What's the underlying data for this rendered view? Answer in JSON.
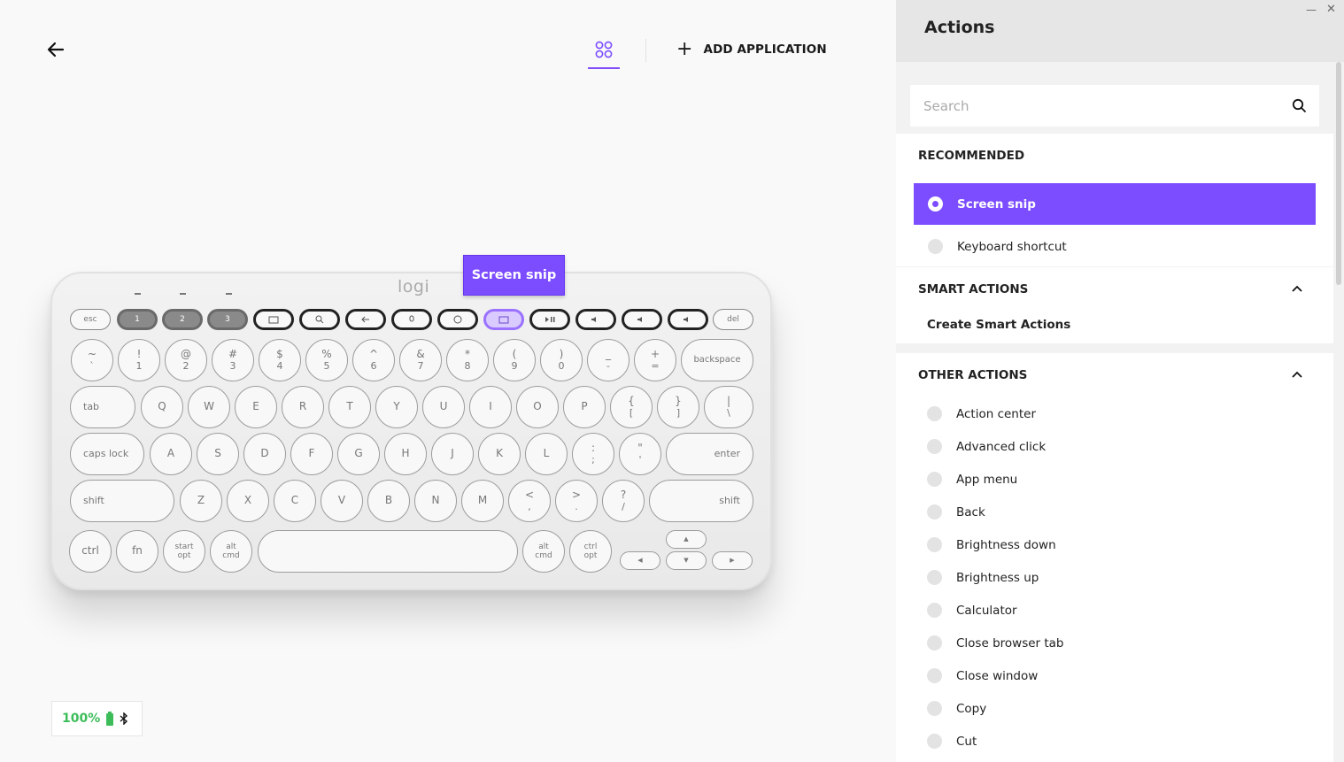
{
  "header": {
    "add_application_label": "ADD APPLICATION"
  },
  "callout": {
    "label": "Screen snip"
  },
  "battery": {
    "percent": "100%"
  },
  "keyboard": {
    "logo": "logi",
    "fn_row": [
      "esc",
      "1",
      "2",
      "3",
      "",
      "",
      "",
      "",
      "",
      "",
      "",
      "",
      "",
      "",
      "del"
    ],
    "row1": [
      {
        "top": "~",
        "bottom": "`"
      },
      {
        "top": "!",
        "bottom": "1"
      },
      {
        "top": "@",
        "bottom": "2"
      },
      {
        "top": "#",
        "bottom": "3"
      },
      {
        "top": "$",
        "bottom": "4"
      },
      {
        "top": "%",
        "bottom": "5"
      },
      {
        "top": "^",
        "bottom": "6"
      },
      {
        "top": "&",
        "bottom": "7"
      },
      {
        "top": "*",
        "bottom": "8"
      },
      {
        "top": "(",
        "bottom": "9"
      },
      {
        "top": ")",
        "bottom": "0"
      },
      {
        "top": "_",
        "bottom": "-"
      },
      {
        "top": "+",
        "bottom": "="
      }
    ],
    "backspace": "backspace",
    "tab": "tab",
    "row2": [
      "Q",
      "W",
      "E",
      "R",
      "T",
      "Y",
      "U",
      "I",
      "O",
      "P"
    ],
    "row2_extra": [
      {
        "top": "{",
        "bottom": "["
      },
      {
        "top": "}",
        "bottom": "]"
      },
      {
        "top": "|",
        "bottom": "\\"
      }
    ],
    "caps": "caps lock",
    "row3": [
      "A",
      "S",
      "D",
      "F",
      "G",
      "H",
      "J",
      "K",
      "L"
    ],
    "row3_extra": [
      {
        "top": ":",
        "bottom": ";"
      },
      {
        "top": "\"",
        "bottom": "'"
      }
    ],
    "enter": "enter",
    "shift": "shift",
    "row4": [
      "Z",
      "X",
      "C",
      "V",
      "B",
      "N",
      "M"
    ],
    "row4_extra": [
      {
        "top": "<",
        "bottom": ","
      },
      {
        "top": ">",
        "bottom": "."
      },
      {
        "top": "?",
        "bottom": "/"
      }
    ],
    "ctrl": "ctrl",
    "fn": "fn",
    "start": {
      "top": "start",
      "bottom": "opt"
    },
    "alt_l": {
      "top": "alt",
      "bottom": "cmd"
    },
    "alt_r": {
      "top": "alt",
      "bottom": "cmd"
    },
    "ctrl_r": {
      "top": "ctrl",
      "bottom": "opt"
    }
  },
  "panel": {
    "title": "Actions",
    "search_placeholder": "Search",
    "recommended_title": "RECOMMENDED",
    "recommended": [
      {
        "label": "Screen snip",
        "selected": true
      },
      {
        "label": "Keyboard shortcut",
        "selected": false
      }
    ],
    "smart_title": "SMART ACTIONS",
    "create_smart": "Create Smart Actions",
    "other_title": "OTHER ACTIONS",
    "other": [
      "Action center",
      "Advanced click",
      "App menu",
      "Back",
      "Brightness down",
      "Brightness up",
      "Calculator",
      "Close browser tab",
      "Close window",
      "Copy",
      "Cut"
    ]
  },
  "colors": {
    "accent": "#7c4dff",
    "battery": "#3dbd5a"
  }
}
